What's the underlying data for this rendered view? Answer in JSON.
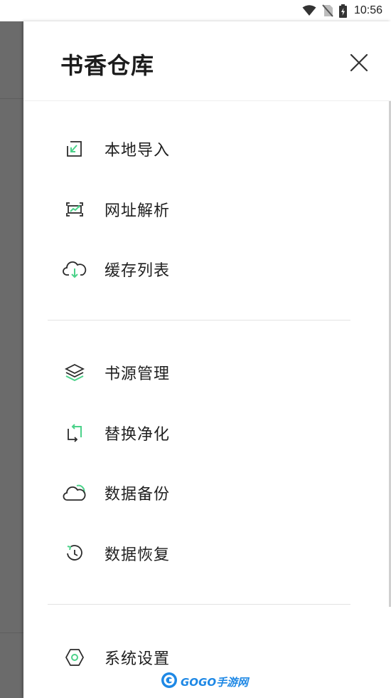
{
  "status_bar": {
    "time": "10:56",
    "icons": [
      "wifi-icon",
      "no-sim-icon",
      "battery-charging-icon"
    ]
  },
  "drawer": {
    "title": "书香仓库",
    "close_icon": "close-icon"
  },
  "menu": {
    "groups": [
      [
        {
          "label": "本地导入",
          "icon": "local-import-icon"
        },
        {
          "label": "网址解析",
          "icon": "url-parse-icon"
        },
        {
          "label": "缓存列表",
          "icon": "cloud-download-icon"
        }
      ],
      [
        {
          "label": "书源管理",
          "icon": "layers-icon"
        },
        {
          "label": "替换净化",
          "icon": "replace-icon"
        },
        {
          "label": "数据备份",
          "icon": "cloud-backup-icon"
        },
        {
          "label": "数据恢复",
          "icon": "restore-clock-icon"
        }
      ],
      [
        {
          "label": "系统设置",
          "icon": "settings-hex-icon"
        }
      ]
    ]
  },
  "watermark": {
    "text": "GOGO手游网"
  },
  "colors": {
    "accent_green": "#4cd28a",
    "icon_dark": "#2b2b2b",
    "divider": "#e3e3e3",
    "scrim": "#6b6b6b"
  }
}
